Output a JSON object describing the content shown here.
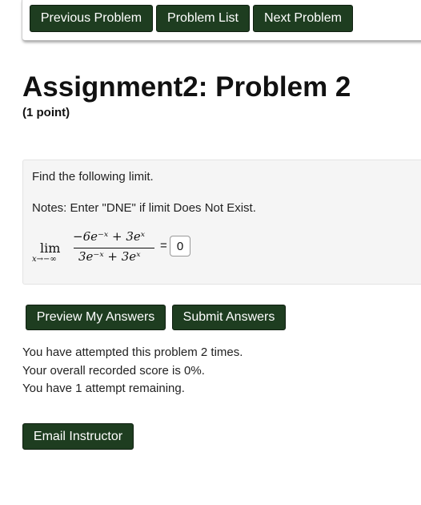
{
  "nav": {
    "previous_label": "Previous Problem",
    "list_label": "Problem List",
    "next_label": "Next Problem"
  },
  "problem": {
    "title": "Assignment2: Problem 2",
    "points": "(1 point)",
    "instruction": "Find the following limit.",
    "notes": "Notes: Enter \"DNE\" if limit Does Not Exist.",
    "math": {
      "lim": "lim",
      "lim_sub": "x→−∞",
      "numerator": "−6e⁻ˣ + 3eˣ",
      "denominator": "3e⁻ˣ + 3eˣ",
      "equals": "="
    },
    "answer_value": "0"
  },
  "actions": {
    "preview_label": "Preview My Answers",
    "submit_label": "Submit Answers"
  },
  "status": {
    "attempts": "You have attempted this problem 2 times.",
    "score": "Your overall recorded score is 0%.",
    "remaining": "You have 1 attempt remaining."
  },
  "footer": {
    "email_label": "Email Instructor"
  },
  "colors": {
    "button_bg": "#1e3d20",
    "button_text": "#ffffff",
    "problem_box_bg": "#f5f5f5"
  }
}
